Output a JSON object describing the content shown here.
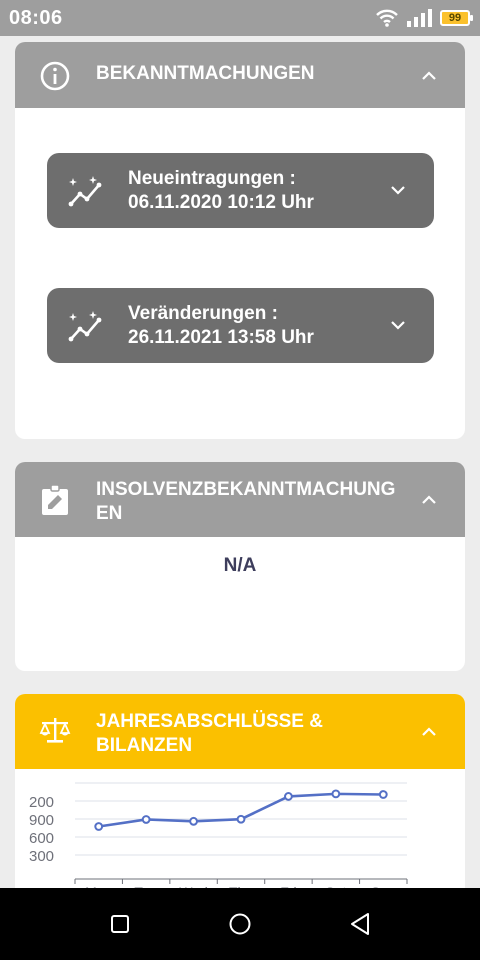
{
  "status_bar": {
    "time": "08:06",
    "battery": "99",
    "icons": [
      "wifi-icon",
      "signal-icon",
      "battery-icon"
    ]
  },
  "bekanntmachungen": {
    "title": "BEKANNTMACHUNGEN",
    "icon": "info-icon",
    "entries": [
      {
        "label": "Neueintragungen :",
        "date": "06.11.2020 10:12 Uhr",
        "icon": "sparkline-icon"
      },
      {
        "label": "Veränderungen :",
        "date": "26.11.2021 13:58 Uhr",
        "icon": "sparkline-icon"
      }
    ]
  },
  "insolvenz": {
    "title_line1": "INSOLVENZBEKANNTMACHUNG",
    "title_line2": "EN",
    "icon": "clipboard-edit-icon",
    "value": "N/A"
  },
  "jahresabschluesse": {
    "title_line1": "JAHRESABSCHLÜSSE &",
    "title_line2": "BILANZEN",
    "icon": "scale-icon",
    "accent": "#fbc000"
  },
  "chart_data": {
    "type": "line",
    "y_tick_labels": [
      "200",
      "900",
      "600",
      "300"
    ],
    "categories": [
      "Mon",
      "Tue",
      "Wed",
      "Thu",
      "Fri",
      "Sat",
      "Sun"
    ],
    "values": [
      820,
      930,
      901,
      934,
      1290,
      1330,
      1320
    ],
    "color": "#5470c6",
    "grid": true
  },
  "colors": {
    "header_gray": "#9e9e9e",
    "entry_gray": "#6e6e6e",
    "accent_yellow": "#fbc000",
    "line_blue": "#5470c6"
  },
  "nav_bar": {
    "icons": [
      "recents-icon",
      "home-icon",
      "back-icon"
    ]
  }
}
